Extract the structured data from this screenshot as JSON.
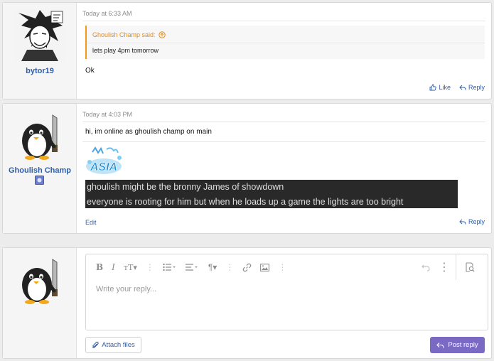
{
  "posts": [
    {
      "username": "bytor19",
      "timestamp": "Today at 6:33 AM",
      "quote": {
        "author_label": "Ghoulish Champ said:",
        "text": "lets play 4pm tomorrow"
      },
      "message": "Ok",
      "actions": {
        "like": "Like",
        "reply": "Reply"
      }
    },
    {
      "username": "Ghoulish Champ",
      "timestamp": "Today at 4:03 PM",
      "message": "hi, im online as ghoulish champ on main",
      "signature_logo_text": "ASIA",
      "signature_lines": [
        "ghoulish might be the bronny James of showdown",
        "everyone is rooting for him but when he loads up a game the lights are too bright"
      ],
      "actions": {
        "edit": "Edit",
        "reply": "Reply"
      }
    }
  ],
  "reply_box": {
    "placeholder": "Write your reply...",
    "attach_label": "Attach files",
    "post_label": "Post reply",
    "toolbar_icons": [
      "bold-icon",
      "italic-icon",
      "text-size-icon",
      "more-icon",
      "list-icon",
      "align-icon",
      "paragraph-icon",
      "more-icon",
      "link-icon",
      "image-icon",
      "more-icon",
      "undo-icon",
      "more-icon",
      "preview-icon"
    ]
  },
  "colors": {
    "link": "#2f5ea8",
    "quote_accent": "#f09a1c",
    "post_button": "#7a6ac4",
    "page_background": "#ececec"
  }
}
